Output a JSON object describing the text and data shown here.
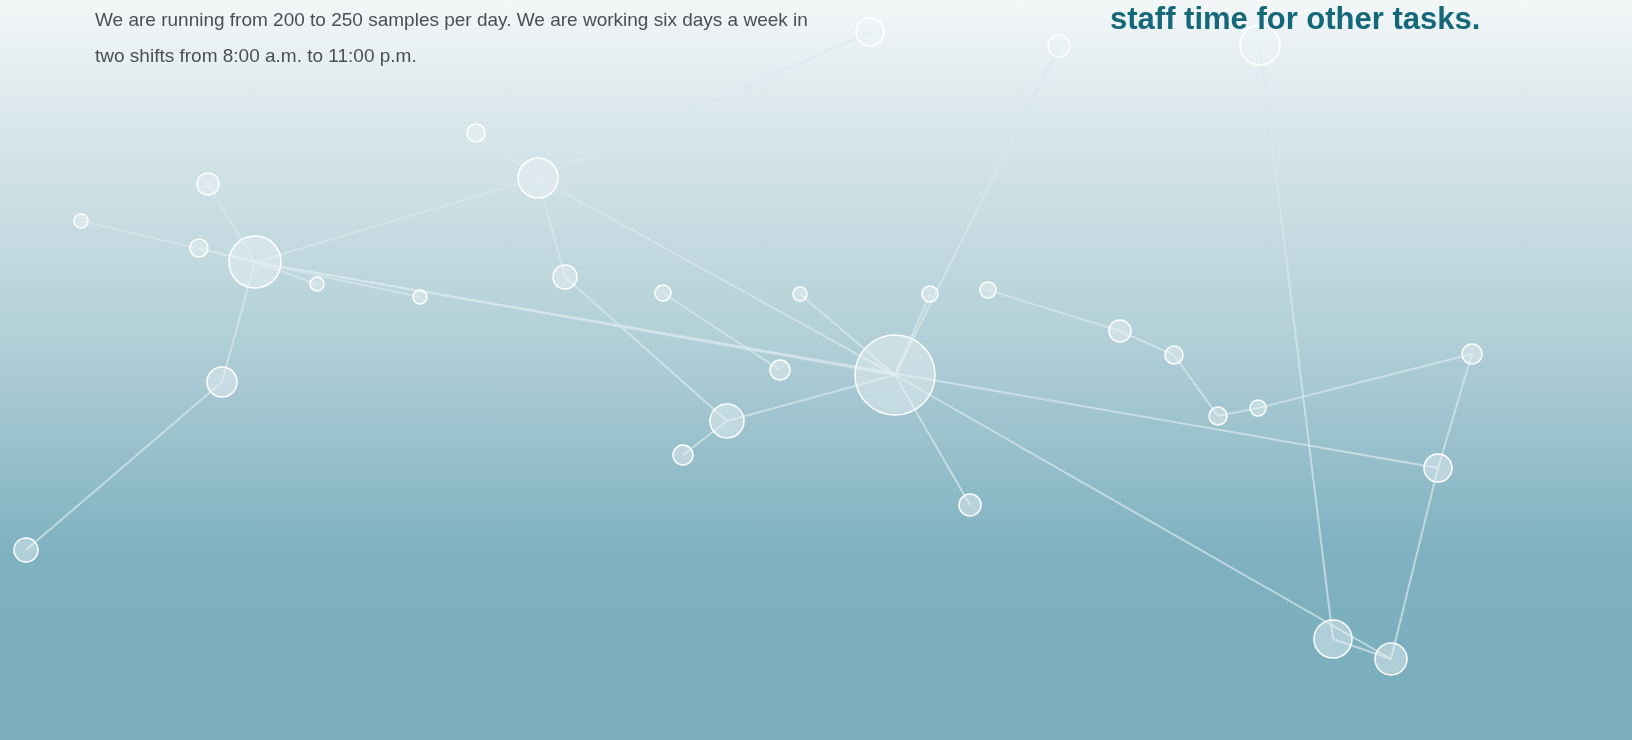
{
  "intro_paragraph": "We are running from 200 to 250 samples per day. We are working six days a week in two shifts from 8:00 a.m. to 11:00 p.m.",
  "heading": "staff time for other tasks."
}
